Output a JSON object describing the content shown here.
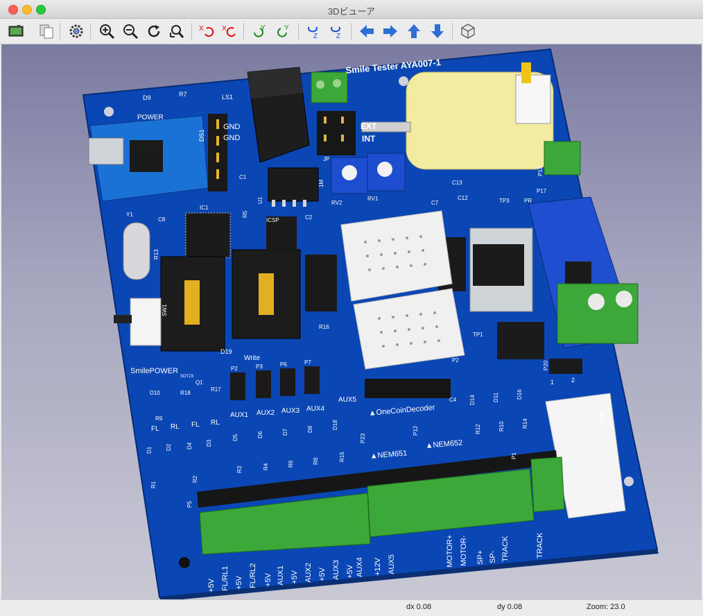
{
  "window": {
    "title": "3Dビューア"
  },
  "toolbar": {
    "buttons": [
      {
        "icon": "render-raytrace-icon"
      },
      {
        "icon": "copy-to-clipboard-icon"
      },
      {
        "icon": "settings-icon"
      },
      {
        "icon": "zoom-in-icon"
      },
      {
        "icon": "zoom-out-icon"
      },
      {
        "icon": "redraw-icon"
      },
      {
        "icon": "zoom-fit-icon"
      },
      {
        "icon": "rotate-x-cw-icon",
        "label": "X"
      },
      {
        "icon": "rotate-x-ccw-icon",
        "label": "X"
      },
      {
        "icon": "rotate-y-cw-icon",
        "label": "Y"
      },
      {
        "icon": "rotate-y-ccw-icon",
        "label": "Y"
      },
      {
        "icon": "rotate-z-cw-icon",
        "label": "Z"
      },
      {
        "icon": "rotate-z-ccw-icon",
        "label": "Z"
      },
      {
        "icon": "move-left-icon"
      },
      {
        "icon": "move-right-icon"
      },
      {
        "icon": "move-up-icon"
      },
      {
        "icon": "move-down-icon"
      },
      {
        "icon": "orthographic-cube-icon"
      }
    ]
  },
  "colors": {
    "pcb_blue": "#0a46b4",
    "terminal_green": "#3da83a",
    "socket_black": "#1c1c1c",
    "breadboard_white": "#f0f0f0",
    "motor_yellow": "#f2eca0"
  },
  "board": {
    "title": "Smile Tester AYA007-1",
    "labels": {
      "power": "POWER",
      "ls1": "LS1",
      "ic1": "IC1",
      "u1": "U1",
      "ds1": "DS1",
      "gnd1": "GND",
      "gnd2": "GND",
      "ext": "EXT",
      "int": "INT",
      "jp": "JP",
      "m1": "1M",
      "rv2": "RV2",
      "rv1": "RV1",
      "c1": "C1",
      "c2": "C2",
      "c7": "C7",
      "c8": "C8",
      "c12": "C12",
      "c13": "C13",
      "c4": "C4",
      "tp1": "TP1",
      "tp2": "P2",
      "tp3": "TP3",
      "p13": "P13",
      "p17": "P17",
      "p20": "P20",
      "pr": "PR",
      "d9": "D9",
      "r7": "R7",
      "r5": "R5",
      "r13": "R13",
      "y1": "Y1",
      "icsp": "ICSP",
      "sw1": "SW1",
      "d19": "D19",
      "write": "Write",
      "r16": "R16",
      "smilepower": "SmilePOWER",
      "q1": "Q1",
      "sot23": "SOT23",
      "d10": "D10",
      "r17": "R17",
      "r18": "R18",
      "r9": "R9",
      "p2": "P2",
      "p3": "P3",
      "p6": "P6",
      "p7": "P7",
      "aux1": "AUX1",
      "aux2": "AUX2",
      "aux3": "AUX3",
      "aux4": "AUX4",
      "aux5": "AUX5",
      "onecoin": "▲OneCoinDecoder",
      "nem651": "▲NEM651",
      "nem652": "▲NEM652",
      "p23": "P23",
      "p12": "P12",
      "d14": "D14",
      "d11": "D11",
      "d16": "D16",
      "r10": "R10",
      "r12": "R12",
      "r14": "R14",
      "p1": "P1",
      "d1": "D1",
      "d2": "D2",
      "d3": "D3",
      "d4": "D4",
      "d5": "D5",
      "d6": "D6",
      "d7": "D7",
      "d8": "D8",
      "d18": "D18",
      "r1": "R1",
      "r2": "R2",
      "r3": "R3",
      "r4": "R4",
      "r6": "R6",
      "r8": "R8",
      "r15": "R15",
      "p5": "P5",
      "fl1": "FL",
      "rl1": "RL",
      "fl2": "FL",
      "rl2": "RL",
      "one": "1",
      "two": "2",
      "dcc": "DCC"
    },
    "terminal_labels": [
      "+5V",
      "FL/RL1",
      "+5V",
      "FL/RL2",
      "+5V",
      "AUX1",
      "+5V",
      "AUX2",
      "+5V",
      "AUX3",
      "+5V",
      "AUX4",
      "+12V",
      "AUX5",
      "MOTOR+",
      "MOTOR-",
      "SP+",
      "SP-",
      "TRACK",
      "TRACK"
    ]
  },
  "status": {
    "dx": "dx 0.08",
    "dy": "dy 0.08",
    "zoom": "Zoom: 23.0"
  }
}
